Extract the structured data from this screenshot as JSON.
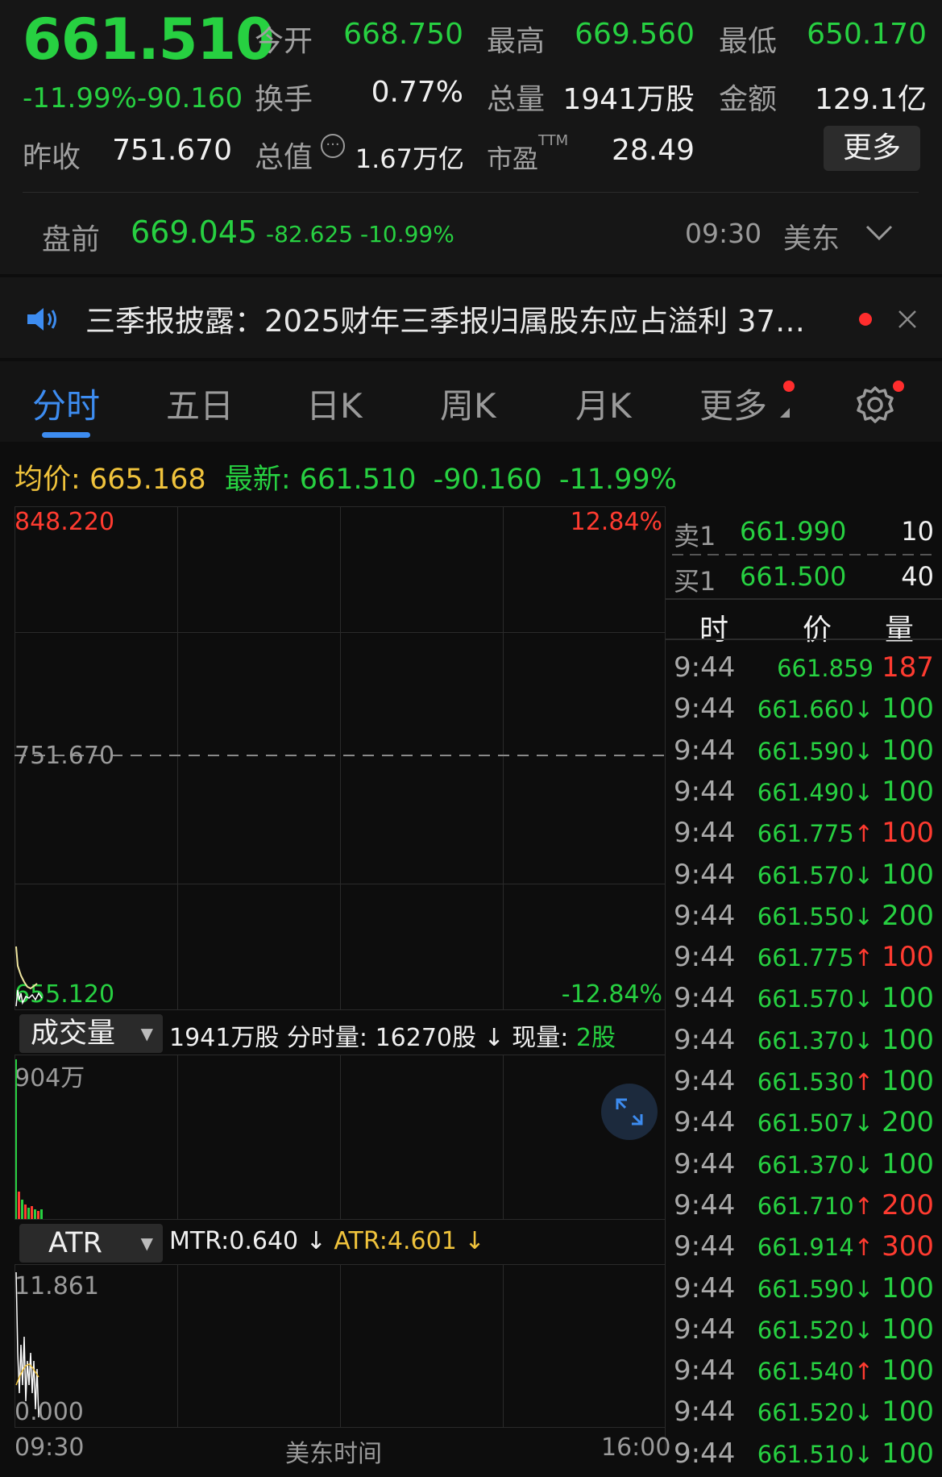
{
  "quote": {
    "price": "661.510",
    "change_pct": "-11.99%",
    "change": "-90.160",
    "fields": {
      "open_label": "今开",
      "open": "668.750",
      "high_label": "最高",
      "high": "669.560",
      "low_label": "最低",
      "low": "650.170",
      "turnover_label": "换手",
      "turnover": "0.77%",
      "volume_label": "总量",
      "volume": "1941万股",
      "amount_label": "金额",
      "amount": "129.1亿",
      "prev_close_label": "昨收",
      "prev_close": "751.670",
      "mcap_label": "总值",
      "mcap": "1.67万亿",
      "pe_label": "市盈",
      "pe_sup": "TTM",
      "pe": "28.49"
    },
    "more_label": "更多"
  },
  "premarket": {
    "label": "盘前",
    "price": "669.045",
    "change": "-82.625",
    "change_pct": "-10.99%",
    "time": "09:30",
    "zone": "美东"
  },
  "news": {
    "text": "三季报披露：2025财年三季报归属股东应占溢利 37…"
  },
  "tabs": [
    "分时",
    "五日",
    "日K",
    "周K",
    "月K",
    "更多"
  ],
  "avg": {
    "avg_label": "均价:",
    "avg_value": "665.168",
    "latest_label": "最新:",
    "latest_value": "661.510",
    "latest_change": "-90.160",
    "latest_pct": "-11.99%"
  },
  "chart": {
    "price_top": "848.220",
    "pct_top": "12.84%",
    "prev_close_line": "751.670",
    "price_bottom": "655.120",
    "pct_bottom": "-12.84%",
    "volume": {
      "selector": "成交量",
      "info_total": "1941万股",
      "info_tick_label": "分时量:",
      "info_tick": "16270股",
      "info_now_label": "现量:",
      "info_now": "2股",
      "max_label": "904万"
    },
    "atr": {
      "selector": "ATR",
      "mtr_label": "MTR:0.640",
      "atr_label": "ATR:4.601",
      "max_label": "11.861",
      "min_label": "0.000"
    },
    "time_start": "09:30",
    "time_mid": "美东时间",
    "time_end": "16:00"
  },
  "book": {
    "ask_label": "卖1",
    "ask_price": "661.990",
    "ask_vol": "10",
    "bid_label": "买1",
    "bid_price": "661.500",
    "bid_vol": "40",
    "col_time": "时",
    "col_price": "价",
    "col_vol": "量",
    "ticks": [
      {
        "t": "9:44",
        "p": "661.859",
        "v": "187",
        "dir": "",
        "vc": "red"
      },
      {
        "t": "9:44",
        "p": "661.660↓",
        "v": "100",
        "dir": "down",
        "vc": "green"
      },
      {
        "t": "9:44",
        "p": "661.590↓",
        "v": "100",
        "dir": "down",
        "vc": "green"
      },
      {
        "t": "9:44",
        "p": "661.490↓",
        "v": "100",
        "dir": "down",
        "vc": "green"
      },
      {
        "t": "9:44",
        "p": "661.775↑",
        "v": "100",
        "dir": "up",
        "vc": "red"
      },
      {
        "t": "9:44",
        "p": "661.570↓",
        "v": "100",
        "dir": "down",
        "vc": "green"
      },
      {
        "t": "9:44",
        "p": "661.550↓",
        "v": "200",
        "dir": "down",
        "vc": "green"
      },
      {
        "t": "9:44",
        "p": "661.775↑",
        "v": "100",
        "dir": "up",
        "vc": "red"
      },
      {
        "t": "9:44",
        "p": "661.570↓",
        "v": "100",
        "dir": "down",
        "vc": "green"
      },
      {
        "t": "9:44",
        "p": "661.370↓",
        "v": "100",
        "dir": "down",
        "vc": "green"
      },
      {
        "t": "9:44",
        "p": "661.530↑",
        "v": "100",
        "dir": "up",
        "vc": "green"
      },
      {
        "t": "9:44",
        "p": "661.507↓",
        "v": "200",
        "dir": "down",
        "vc": "green"
      },
      {
        "t": "9:44",
        "p": "661.370↓",
        "v": "100",
        "dir": "down",
        "vc": "green"
      },
      {
        "t": "9:44",
        "p": "661.710↑",
        "v": "200",
        "dir": "up",
        "vc": "red"
      },
      {
        "t": "9:44",
        "p": "661.914↑",
        "v": "300",
        "dir": "up",
        "vc": "red"
      },
      {
        "t": "9:44",
        "p": "661.590↓",
        "v": "100",
        "dir": "down",
        "vc": "green"
      },
      {
        "t": "9:44",
        "p": "661.520↓",
        "v": "100",
        "dir": "down",
        "vc": "green"
      },
      {
        "t": "9:44",
        "p": "661.540↑",
        "v": "100",
        "dir": "up",
        "vc": "green"
      },
      {
        "t": "9:44",
        "p": "661.520↓",
        "v": "100",
        "dir": "down",
        "vc": "green"
      },
      {
        "t": "9:44",
        "p": "661.510↓",
        "v": "100",
        "dir": "down",
        "vc": "green"
      }
    ]
  },
  "colors": {
    "up": "#ff3b30",
    "down": "#27d041",
    "accent": "#3d8cf0",
    "avg": "#f0c33c"
  }
}
